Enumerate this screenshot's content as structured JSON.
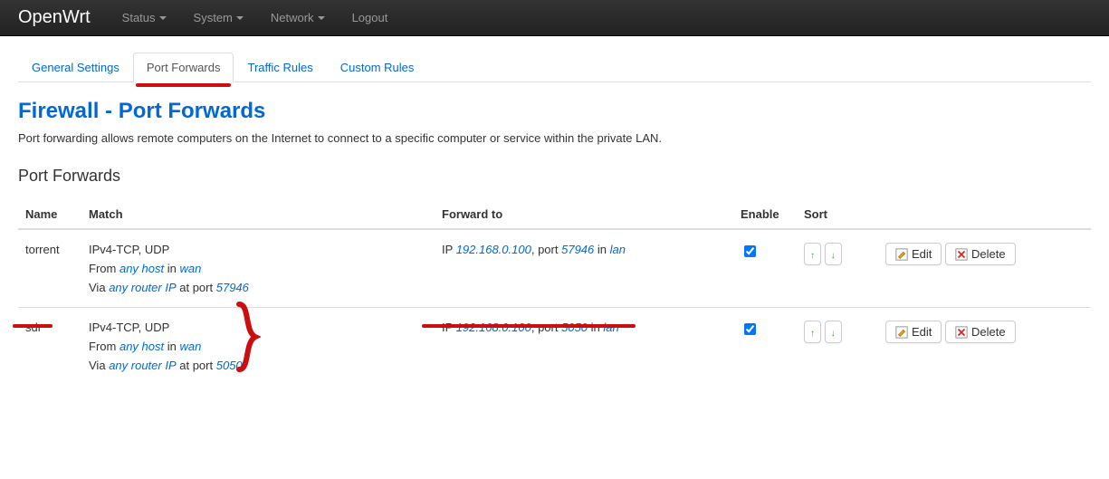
{
  "navbar": {
    "brand": "OpenWrt",
    "items": [
      {
        "label": "Status",
        "dropdown": true
      },
      {
        "label": "System",
        "dropdown": true
      },
      {
        "label": "Network",
        "dropdown": true
      },
      {
        "label": "Logout",
        "dropdown": false
      }
    ]
  },
  "tabs": [
    {
      "label": "General Settings",
      "active": false
    },
    {
      "label": "Port Forwards",
      "active": true
    },
    {
      "label": "Traffic Rules",
      "active": false
    },
    {
      "label": "Custom Rules",
      "active": false
    }
  ],
  "page": {
    "title": "Firewall - Port Forwards",
    "description": "Port forwarding allows remote computers on the Internet to connect to a specific computer or service within the private LAN.",
    "section_title": "Port Forwards"
  },
  "table": {
    "headers": {
      "name": "Name",
      "match": "Match",
      "forward": "Forward to",
      "enable": "Enable",
      "sort": "Sort"
    },
    "rows": [
      {
        "name": "torrent",
        "match_proto": "IPv4-TCP, UDP",
        "from_host": "any host",
        "from_zone": "wan",
        "via_router": "any router IP",
        "via_port": "57946",
        "fwd_ip": "192.168.0.100",
        "fwd_port": "57946",
        "fwd_zone": "lan",
        "enabled": true
      },
      {
        "name": "sdr",
        "match_proto": "IPv4-TCP, UDP",
        "from_host": "any host",
        "from_zone": "wan",
        "via_router": "any router IP",
        "via_port": "5050",
        "fwd_ip": "192.168.0.100",
        "fwd_port": "5050",
        "fwd_zone": "lan",
        "enabled": true
      }
    ]
  },
  "labels": {
    "from": "From",
    "in": "in",
    "via": "Via",
    "at_port": "at port",
    "ip": "IP",
    "port": "port",
    "edit": "Edit",
    "delete": "Delete"
  }
}
